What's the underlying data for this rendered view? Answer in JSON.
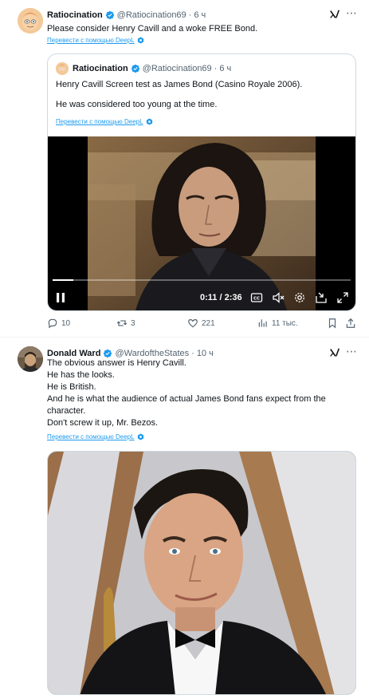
{
  "tweets": [
    {
      "author_name": "Ratiocination",
      "author_handle": "@Ratiocination69",
      "time": "6 ч",
      "text": "Please consider Henry Cavill and a woke FREE Bond.",
      "translate_label": "Перевести с помощью DeepL",
      "quote": {
        "author_name": "Ratiocination",
        "author_handle": "@Ratiocination69",
        "time": "6 ч",
        "text_line1": "Henry Cavill Screen test as James Bond (Casino Royale 2006).",
        "text_line2": "He was considered too young at the time.",
        "translate_label": "Перевести с помощью DeepL",
        "video": {
          "current_time": "0:11",
          "duration": "2:36",
          "time_display": "0:11 / 2:36",
          "progress": 0.07
        }
      },
      "actions": {
        "replies": "10",
        "retweets": "3",
        "likes": "221",
        "views": "11 тыс."
      }
    },
    {
      "author_name": "Donald Ward",
      "author_handle": "@WardoftheStates",
      "time": "10 ч",
      "lines": [
        "The obvious answer is Henry Cavill.",
        "He has the looks.",
        "He is British.",
        "And he is what the audience of actual James Bond fans expect from the",
        "character.",
        "Don't screw it up, Mr. Bezos."
      ],
      "translate_label": "Перевести с помощью DeepL"
    }
  ],
  "colors": {
    "accent": "#1d9bf0",
    "text": "#0f1419",
    "muted": "#536471",
    "border": "#cfd9de"
  },
  "icons": {
    "verified": "verified-badge-icon",
    "grok": "grok-icon",
    "more": "more-icon",
    "deepl": "deepl-icon",
    "reply": "reply-icon",
    "retweet": "retweet-icon",
    "like": "like-icon",
    "views": "views-icon",
    "bookmark": "bookmark-icon",
    "share": "share-icon"
  }
}
